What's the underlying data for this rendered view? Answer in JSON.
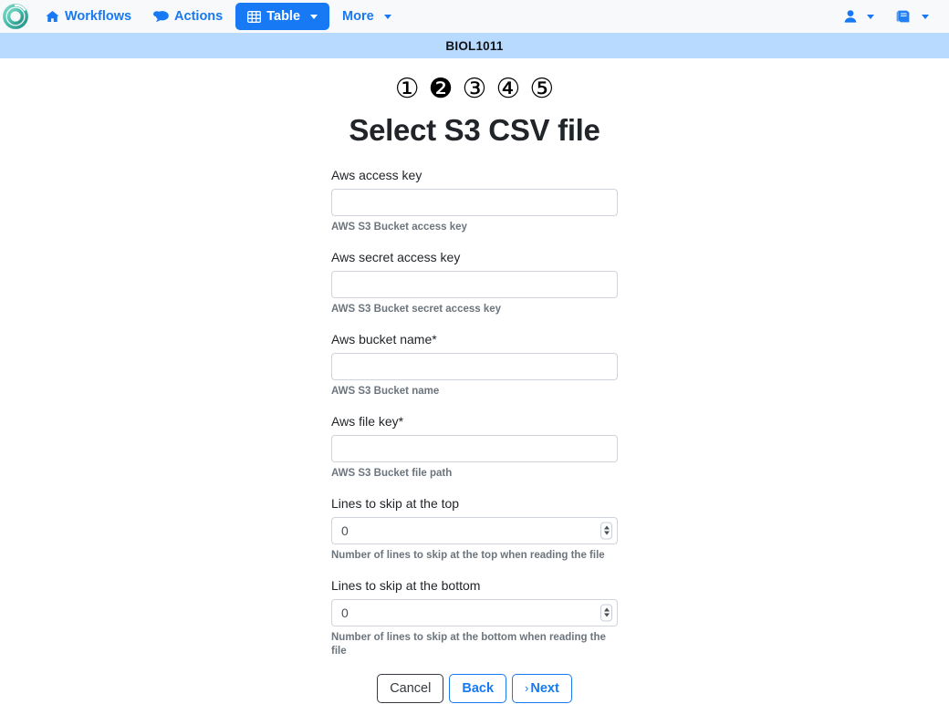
{
  "navbar": {
    "brand_icon": "logo-ring-icon",
    "items": [
      {
        "label": "Workflows",
        "icon": "home-icon",
        "active": false,
        "caret": false
      },
      {
        "label": "Actions",
        "icon": "comments-icon",
        "active": false,
        "caret": false
      },
      {
        "label": "Table",
        "icon": "table-grid-icon",
        "active": true,
        "caret": true
      },
      {
        "label": "More",
        "icon": "",
        "active": false,
        "caret": true
      }
    ],
    "right": [
      {
        "name": "user-menu",
        "icon": "user-icon",
        "caret": true
      },
      {
        "name": "docs-menu",
        "icon": "book-icon",
        "caret": true
      }
    ]
  },
  "subheader": {
    "title": "BIOL1011"
  },
  "wizard": {
    "steps": [
      {
        "label": "①",
        "number": "1",
        "active": false
      },
      {
        "label": "❷",
        "number": "2",
        "active": true
      },
      {
        "label": "③",
        "number": "3",
        "active": false
      },
      {
        "label": "④",
        "number": "4",
        "active": false
      },
      {
        "label": "⑤",
        "number": "5",
        "active": false
      }
    ],
    "title": "Select S3 CSV file"
  },
  "form": {
    "fields": [
      {
        "name": "aws-access-key",
        "label": "Aws access key",
        "value": "",
        "placeholder": "",
        "help": "AWS S3 Bucket access key",
        "type": "text"
      },
      {
        "name": "aws-secret-access-key",
        "label": "Aws secret access key",
        "value": "",
        "placeholder": "",
        "help": "AWS S3 Bucket secret access key",
        "type": "text"
      },
      {
        "name": "aws-bucket-name",
        "label": "Aws bucket name*",
        "value": "",
        "placeholder": "",
        "help": "AWS S3 Bucket name",
        "type": "text"
      },
      {
        "name": "aws-file-key",
        "label": "Aws file key*",
        "value": "",
        "placeholder": "",
        "help": "AWS S3 Bucket file path",
        "type": "text"
      },
      {
        "name": "lines-skip-top",
        "label": "Lines to skip at the top",
        "value": "0",
        "placeholder": "",
        "help": "Number of lines to skip at the top when reading the file",
        "type": "number"
      },
      {
        "name": "lines-skip-bottom",
        "label": "Lines to skip at the bottom",
        "value": "0",
        "placeholder": "",
        "help": "Number of lines to skip at the bottom when reading the file",
        "type": "number"
      }
    ]
  },
  "buttons": {
    "cancel": "Cancel",
    "back": "Back",
    "next": "Next",
    "next_chevron": "›"
  },
  "colors": {
    "primary": "#1779f3",
    "navbar_bg": "#f8f9fa",
    "subheader_bg": "#b8daff",
    "border": "#ced4da",
    "help_text": "#6c757d",
    "cancel_border": "#343a40",
    "logo": "#3dbfae"
  }
}
